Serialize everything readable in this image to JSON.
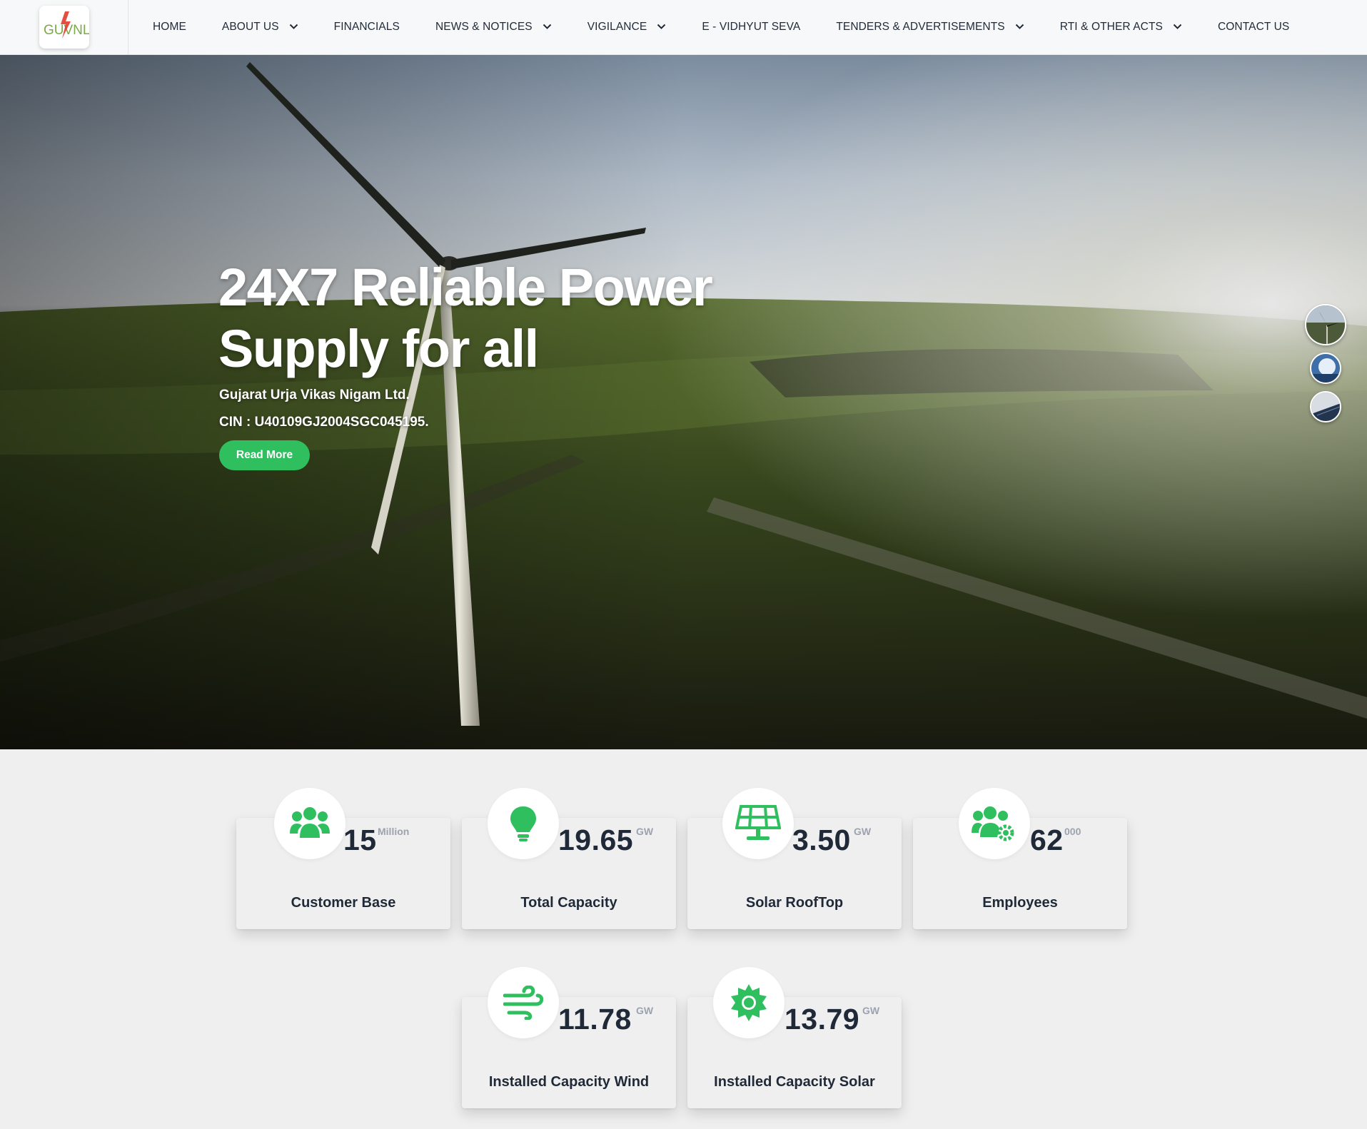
{
  "brand": {
    "logo_text": "GUVNL"
  },
  "nav": {
    "items": [
      {
        "label": "HOME",
        "dropdown": false
      },
      {
        "label": "ABOUT US",
        "dropdown": true
      },
      {
        "label": "FINANCIALS",
        "dropdown": false
      },
      {
        "label": "NEWS & NOTICES",
        "dropdown": true
      },
      {
        "label": "VIGILANCE",
        "dropdown": true
      },
      {
        "label": "E - VIDHYUT SEVA",
        "dropdown": false
      },
      {
        "label": "TENDERS & ADVERTISEMENTS",
        "dropdown": true
      },
      {
        "label": "RTI & OTHER ACTS",
        "dropdown": true
      },
      {
        "label": "CONTACT US",
        "dropdown": false
      }
    ]
  },
  "hero": {
    "title_line1": "24X7 Reliable Power",
    "title_line2": "Supply for all",
    "company": "Gujarat Urja Vikas Nigam Ltd.",
    "cin": "CIN : U40109GJ2004SGC045195.",
    "cta_label": "Read More",
    "active_slide": 1,
    "slide_count": 3
  },
  "stats": [
    {
      "value": "15",
      "unit": "Million",
      "label": "Customer Base",
      "icon": "users-icon"
    },
    {
      "value": "19.65",
      "unit": "GW",
      "label": "Total Capacity",
      "icon": "lightbulb-icon"
    },
    {
      "value": "3.50",
      "unit": "GW",
      "label": "Solar RoofTop",
      "icon": "solar-panel-icon"
    },
    {
      "value": "62",
      "unit": "000",
      "label": "Employees",
      "icon": "users-gear-icon"
    },
    {
      "value": "11.78",
      "unit": "GW",
      "label": "Installed Capacity Wind",
      "icon": "wind-icon"
    },
    {
      "value": "13.79",
      "unit": "GW",
      "label": "Installed Capacity Solar",
      "icon": "sun-icon"
    }
  ],
  "colors": {
    "accent": "#2fbf5f",
    "nav_bg": "#f7f8f9",
    "page_bg": "#efefef",
    "text_dark": "#1f2937"
  }
}
